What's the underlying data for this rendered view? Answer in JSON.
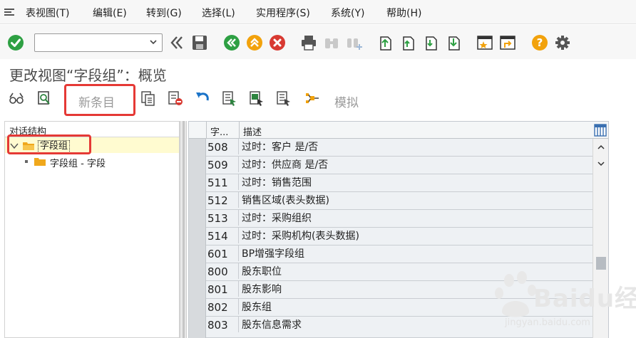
{
  "menu": {
    "items": [
      "表视图(T)",
      "编辑(E)",
      "转到(G)",
      "选择(L)",
      "实用程序(S)",
      "系统(Y)",
      "帮助(H)"
    ]
  },
  "toolbar": {
    "command_field_value": ""
  },
  "page": {
    "title": "更改视图“字段组”：概览"
  },
  "app_toolbar": {
    "new_entries_label": "新条目",
    "simulate_label": "模拟"
  },
  "tree": {
    "header": "对话结构",
    "root_label": "字段组",
    "child_label": "字段组 - 字段"
  },
  "table": {
    "columns": [
      "字...",
      "描述"
    ],
    "rows": [
      {
        "code": "508",
        "desc": "过时：客户 是/否"
      },
      {
        "code": "509",
        "desc": "过时：供应商 是/否"
      },
      {
        "code": "511",
        "desc": "过时：销售范围"
      },
      {
        "code": "512",
        "desc": "销售区域(表头数据)"
      },
      {
        "code": "513",
        "desc": "过时：采购组织"
      },
      {
        "code": "514",
        "desc": "过时：采购机构(表头数据)"
      },
      {
        "code": "601",
        "desc": "BP增强字段组"
      },
      {
        "code": "800",
        "desc": "股东职位"
      },
      {
        "code": "801",
        "desc": "股东影响"
      },
      {
        "code": "802",
        "desc": "股东组"
      },
      {
        "code": "803",
        "desc": "股东信息需求"
      }
    ]
  },
  "watermark": {
    "brand": "Baidu经验",
    "url": "jingyan.baidu.com"
  },
  "colors": {
    "highlight": "#e53935",
    "green": "#2ea043",
    "orange": "#f2a20c",
    "red": "#d83a32",
    "selection": "#fffbd0"
  }
}
